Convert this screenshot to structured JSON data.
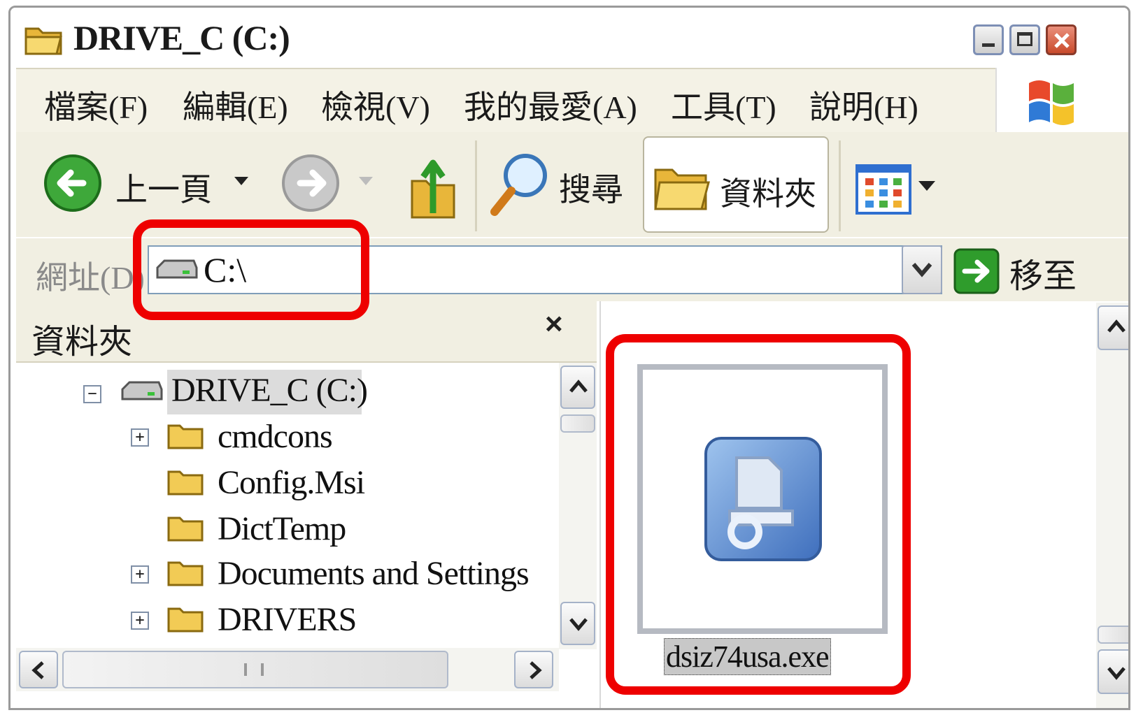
{
  "window": {
    "title": "DRIVE_C (C:)"
  },
  "menu": [
    "檔案(F)",
    "編輯(E)",
    "檢視(V)",
    "我的最愛(A)",
    "工具(T)",
    "說明(H)"
  ],
  "toolbar": {
    "back": "上一頁",
    "search": "搜尋",
    "folders": "資料夾"
  },
  "address": {
    "label": "網址(D)",
    "value": "C:\\",
    "go": "移至"
  },
  "tree_pane": {
    "title": "資料夾",
    "close": "×",
    "root": "DRIVE_C (C:)",
    "items": [
      {
        "label": "cmdcons",
        "expander": "+"
      },
      {
        "label": "Config.Msi",
        "expander": ""
      },
      {
        "label": "DictTemp",
        "expander": ""
      },
      {
        "label": "Documents and Settings",
        "expander": "+"
      },
      {
        "label": "DRIVERS",
        "expander": "+"
      }
    ],
    "root_expander": "−"
  },
  "file": {
    "name": "dsiz74usa.exe"
  },
  "colors": {
    "highlight": "#ee0000",
    "toolbar_bg": "#f1efe2",
    "selection": "#c8c8c8"
  }
}
